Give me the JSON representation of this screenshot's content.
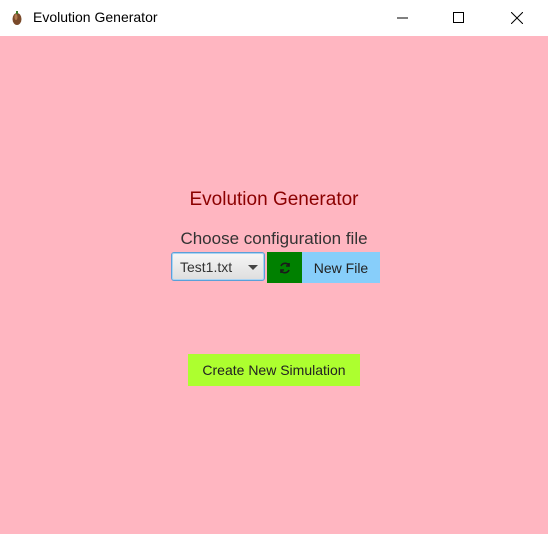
{
  "window": {
    "title": "Evolution Generator",
    "icon": "app-icon"
  },
  "main": {
    "heading": "Evolution Generator",
    "subheading": "Choose configuration file",
    "config_select": {
      "selected": "Test1.txt"
    },
    "refresh_icon": "refresh-icon",
    "new_file_label": "New File",
    "create_label": "Create New Simulation"
  },
  "colors": {
    "background": "#ffb6c1",
    "heading": "#8b0000",
    "refresh_button": "#008000",
    "new_file_button": "#87cefa",
    "create_button": "#adff2f"
  }
}
